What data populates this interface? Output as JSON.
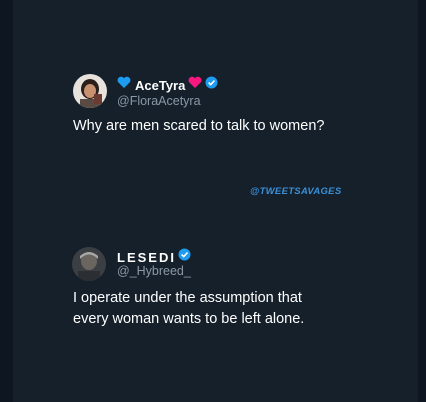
{
  "tweets": [
    {
      "display_name": "AceTyra",
      "handle": "@FloraAcetyra",
      "text_lines": [
        "Why are men scared to talk to women?"
      ],
      "verified": true
    },
    {
      "display_name": "LESEDI",
      "handle": "@_Hybreed_",
      "text_lines": [
        "I operate under the assumption that",
        "every woman wants to be left alone."
      ],
      "verified": true
    }
  ],
  "watermark": "@TWEETSAVAGES",
  "colors": {
    "background": "#15202b",
    "text": "#ffffff",
    "handle": "#8b98a5",
    "verified": "#1d9bf0",
    "blue_heart": "#1d9bf0",
    "red_heart": "#f91880",
    "watermark": "#3a8fd8"
  },
  "icons": {
    "left_emoji": "blue-heart-icon",
    "right_emoji": "red-heart-icon",
    "verified": "verified-badge-icon"
  }
}
